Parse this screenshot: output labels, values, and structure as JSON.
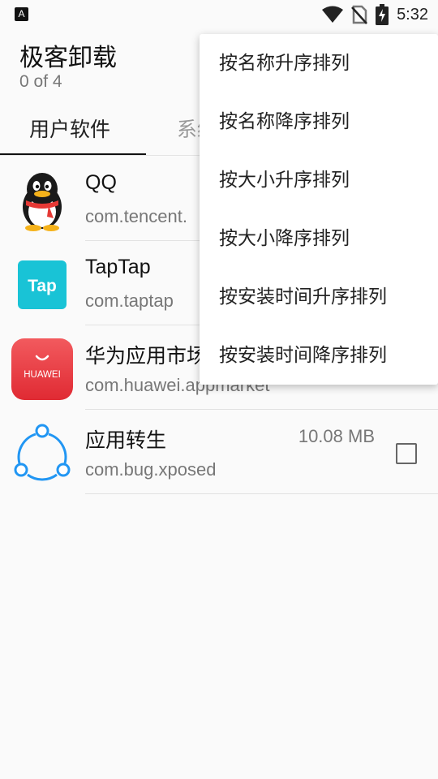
{
  "status_bar": {
    "left_icon": "A",
    "time": "5:32",
    "icons": [
      "wifi-icon",
      "no-sim-icon",
      "battery-charging-icon"
    ]
  },
  "app_bar": {
    "title": "极客卸载",
    "subtitle": "0 of 4"
  },
  "tabs": [
    {
      "label": "用户软件",
      "active": true
    },
    {
      "label": "系统软件",
      "active": false
    }
  ],
  "apps": [
    {
      "name": "QQ",
      "package": "com.tencent.",
      "size": "",
      "icon": "qq-penguin-icon"
    },
    {
      "name": "TapTap",
      "package": "com.taptap",
      "size": "",
      "icon": "taptap-icon"
    },
    {
      "name": "华为应用市场",
      "package": "com.huawei.appmarket",
      "size": "",
      "icon": "huawei-appgallery-icon",
      "icon_text": "HUAWEI"
    },
    {
      "name": "应用转生",
      "package": "com.bug.xposed",
      "size": "10.08 MB",
      "icon": "share-nodes-icon"
    }
  ],
  "sort_menu": {
    "items": [
      "按名称升序排列",
      "按名称降序排列",
      "按大小升序排列",
      "按大小降序排列",
      "按安装时间升序排列",
      "按安装时间降序排列"
    ]
  },
  "colors": {
    "background": "#fafafa",
    "tab_indicator": "#111111",
    "qq_red": "#e53935",
    "taptap_teal": "#19c3d6",
    "huawei_red": "#e8313a",
    "share_blue": "#2196f3"
  }
}
